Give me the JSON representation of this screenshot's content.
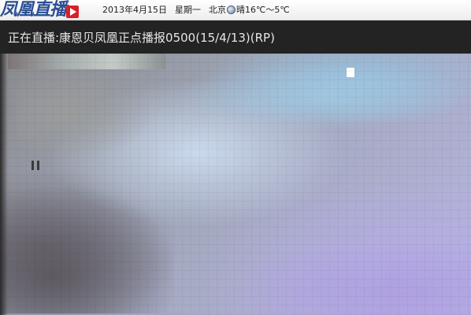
{
  "header": {
    "logo_text": "凤凰直播",
    "logo_icon": "play-icon",
    "date": "2013年4月15日",
    "weekday": "星期一",
    "city": "北京",
    "weather_icon": "weather-icon",
    "weather": "晴16℃～5℃"
  },
  "player": {
    "now_playing": "正在直播:康恩贝凤凰正点播报0500(15/4/13)(RP)"
  },
  "colors": {
    "logo": "#2a4f93",
    "logo_accent": "#d8202a",
    "title_bar": "#232323",
    "title_text": "#e6e6e6"
  }
}
